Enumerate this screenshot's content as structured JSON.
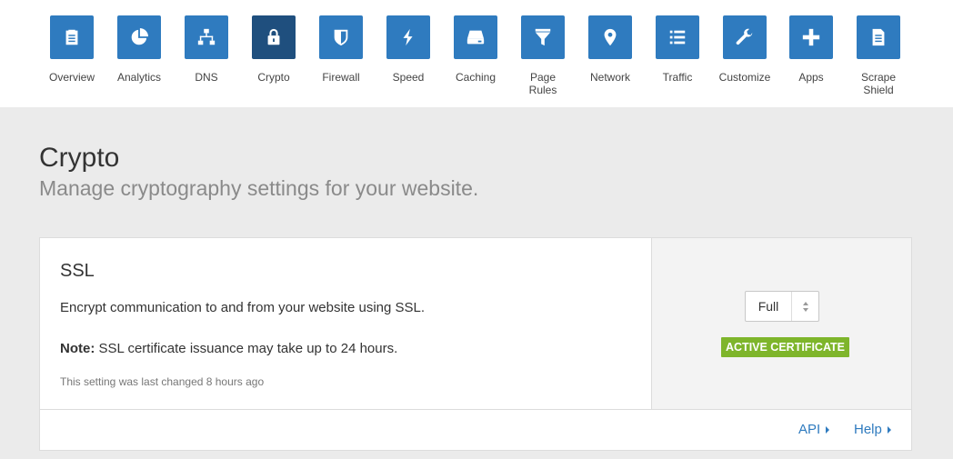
{
  "nav": {
    "items": [
      {
        "label": "Overview",
        "icon": "clipboard-icon"
      },
      {
        "label": "Analytics",
        "icon": "pie-chart-icon"
      },
      {
        "label": "DNS",
        "icon": "network-tree-icon"
      },
      {
        "label": "Crypto",
        "icon": "lock-icon",
        "active": true
      },
      {
        "label": "Firewall",
        "icon": "shield-icon"
      },
      {
        "label": "Speed",
        "icon": "lightning-icon"
      },
      {
        "label": "Caching",
        "icon": "hard-drive-icon"
      },
      {
        "label": "Page Rules",
        "icon": "filter-icon"
      },
      {
        "label": "Network",
        "icon": "map-pin-icon"
      },
      {
        "label": "Traffic",
        "icon": "list-icon"
      },
      {
        "label": "Customize",
        "icon": "wrench-icon"
      },
      {
        "label": "Apps",
        "icon": "plus-icon"
      },
      {
        "label": "Scrape Shield",
        "icon": "document-icon"
      }
    ]
  },
  "page": {
    "title": "Crypto",
    "subtitle": "Manage cryptography settings for your website."
  },
  "ssl_card": {
    "title": "SSL",
    "description": "Encrypt communication to and from your website using SSL.",
    "note_label": "Note:",
    "note_text": " SSL certificate issuance may take up to 24 hours.",
    "last_changed": "This setting was last changed 8 hours ago",
    "select_value": "Full",
    "badge": "ACTIVE CERTIFICATE",
    "api_link": "API",
    "help_link": "Help"
  },
  "colors": {
    "nav_tile": "#2f7bbf",
    "nav_tile_active": "#1f4f7e",
    "badge": "#7eb52b",
    "link": "#2f7bbf"
  }
}
